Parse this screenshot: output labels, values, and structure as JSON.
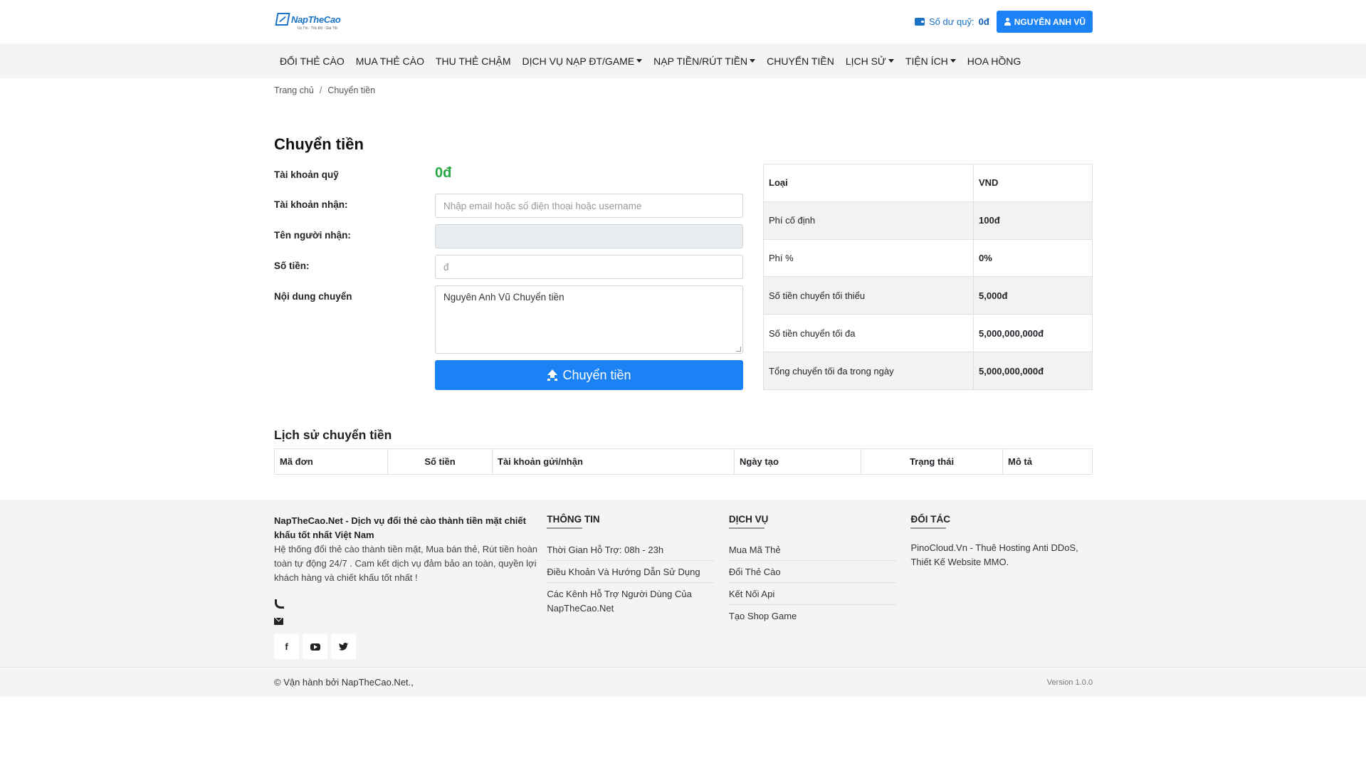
{
  "header": {
    "logo_text": "NapTheCao",
    "logo_tagline": "Uy Tín · Tốc Độ · Giá Tốt",
    "balance_label": "Số dư quỹ:",
    "balance_value": "0đ",
    "user_button": "NGUYỄN ANH VŨ"
  },
  "nav": [
    {
      "label": "ĐỔI THẺ CÀO",
      "dropdown": false
    },
    {
      "label": "MUA THẺ CÀO",
      "dropdown": false
    },
    {
      "label": "THU THẺ CHẬM",
      "dropdown": false
    },
    {
      "label": "DỊCH VỤ NẠP ĐT/GAME",
      "dropdown": true
    },
    {
      "label": "NẠP TIỀN/RÚT TIỀN",
      "dropdown": true
    },
    {
      "label": "CHUYỂN TIỀN",
      "dropdown": false
    },
    {
      "label": "LỊCH SỬ",
      "dropdown": true
    },
    {
      "label": "TIỆN ÍCH",
      "dropdown": true
    },
    {
      "label": "HOA HỒNG",
      "dropdown": false
    }
  ],
  "breadcrumb": {
    "home": "Trang chủ",
    "separator": "/",
    "current": "Chuyển tiền"
  },
  "page_title": "Chuyển tiền",
  "form": {
    "fund_label": "Tài khoản quỹ",
    "fund_value": "0đ",
    "receiver_label": "Tài khoản nhận:",
    "receiver_placeholder": "Nhập email hoặc số điện thoại hoặc username",
    "receiver_name_label": "Tên người nhận:",
    "receiver_name_value": "",
    "amount_label": "Số tiền:",
    "amount_placeholder": "đ",
    "content_label": "Nội dung chuyển",
    "content_value": "Nguyên Anh Vũ Chuyển tiền",
    "submit_label": "Chuyển tiền"
  },
  "fee_table": {
    "header": [
      "Loại",
      "VND"
    ],
    "rows": [
      [
        "Phí cố định",
        "100đ"
      ],
      [
        "Phí %",
        "0%"
      ],
      [
        "Số tiền chuyển tối thiểu",
        "5,000đ"
      ],
      [
        "Số tiền chuyển tối đa",
        "5,000,000,000đ"
      ],
      [
        "Tổng chuyển tối đa trong ngày",
        "5,000,000,000đ"
      ]
    ]
  },
  "history": {
    "title": "Lịch sử chuyển tiền",
    "columns": [
      "Mã đơn",
      "Số tiền",
      "Tài khoản gửi/nhận",
      "Ngày tạo",
      "Trạng thái",
      "Mô tả"
    ]
  },
  "footer": {
    "about_title": "NapTheCao.Net - Dịch vụ đổi thẻ cào thành tiền mặt chiết khấu tốt nhất Việt Nam",
    "about_desc": "Hệ thống đổi thẻ cào thành tiền mặt, Mua bán thẻ, Rút tiền hoàn toàn tự động 24/7 . Cam kết dịch vụ đảm bảo an toàn, quyền lợi khách hàng và chiết khấu tốt nhất !",
    "social": [
      "facebook-icon",
      "youtube-icon",
      "twitter-icon"
    ],
    "info_title": "THÔNG TIN",
    "info_links": [
      "Thời Gian Hỗ Trợ: 08h - 23h",
      "Điều Khoản Và Hướng Dẫn Sử Dụng",
      "Các Kênh Hỗ Trợ Người Dùng Của NapTheCao.Net"
    ],
    "service_title": "DỊCH VỤ",
    "service_links": [
      "Mua Mã Thẻ",
      "Đổi Thẻ Cào",
      "Kết Nối Api",
      "Tạo Shop Game"
    ],
    "partner_title": "ĐỐI TÁC",
    "partner_text": "PinoCloud.Vn - Thuê Hosting Anti DDoS, Thiết Kế Website MMO."
  },
  "copyright": {
    "text": "© Vận hành bởi NapTheCao.Net.,",
    "version": "Version 1.0.0"
  },
  "colors": {
    "primary": "#1a82f5",
    "success": "#28a745",
    "nav_bg": "#f4f4f5"
  }
}
